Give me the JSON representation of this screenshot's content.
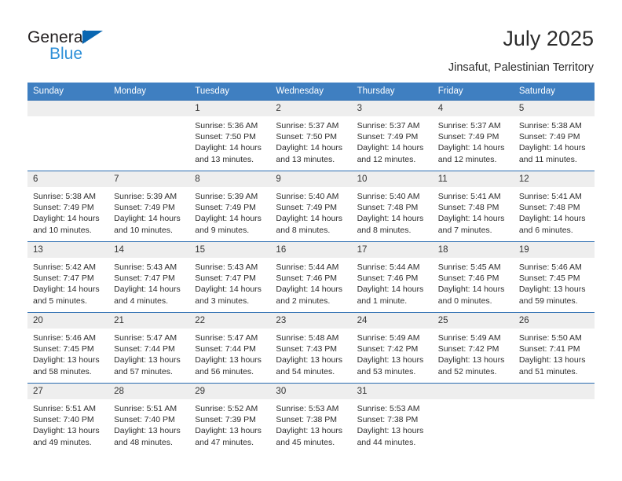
{
  "brand": {
    "name_dark": "General",
    "name_blue": "Blue",
    "accent_blue": "#0a67b2",
    "light_blue": "#2f90d8"
  },
  "header": {
    "title": "July 2025",
    "location": "Jinsafut, Palestinian Territory"
  },
  "theme": {
    "header_bg": "#3f7fc1",
    "row_rule": "#2a6cb0",
    "daynum_bg": "#eeeeee"
  },
  "weekday_headers": [
    "Sunday",
    "Monday",
    "Tuesday",
    "Wednesday",
    "Thursday",
    "Friday",
    "Saturday"
  ],
  "labels": {
    "sunrise": "Sunrise:",
    "sunset": "Sunset:",
    "daylight": "Daylight:"
  },
  "weeks": [
    [
      {
        "day": "",
        "sunrise": "",
        "sunset": "",
        "daylight": ""
      },
      {
        "day": "",
        "sunrise": "",
        "sunset": "",
        "daylight": ""
      },
      {
        "day": "1",
        "sunrise": "Sunrise: 5:36 AM",
        "sunset": "Sunset: 7:50 PM",
        "daylight": "Daylight: 14 hours and 13 minutes."
      },
      {
        "day": "2",
        "sunrise": "Sunrise: 5:37 AM",
        "sunset": "Sunset: 7:50 PM",
        "daylight": "Daylight: 14 hours and 13 minutes."
      },
      {
        "day": "3",
        "sunrise": "Sunrise: 5:37 AM",
        "sunset": "Sunset: 7:49 PM",
        "daylight": "Daylight: 14 hours and 12 minutes."
      },
      {
        "day": "4",
        "sunrise": "Sunrise: 5:37 AM",
        "sunset": "Sunset: 7:49 PM",
        "daylight": "Daylight: 14 hours and 12 minutes."
      },
      {
        "day": "5",
        "sunrise": "Sunrise: 5:38 AM",
        "sunset": "Sunset: 7:49 PM",
        "daylight": "Daylight: 14 hours and 11 minutes."
      }
    ],
    [
      {
        "day": "6",
        "sunrise": "Sunrise: 5:38 AM",
        "sunset": "Sunset: 7:49 PM",
        "daylight": "Daylight: 14 hours and 10 minutes."
      },
      {
        "day": "7",
        "sunrise": "Sunrise: 5:39 AM",
        "sunset": "Sunset: 7:49 PM",
        "daylight": "Daylight: 14 hours and 10 minutes."
      },
      {
        "day": "8",
        "sunrise": "Sunrise: 5:39 AM",
        "sunset": "Sunset: 7:49 PM",
        "daylight": "Daylight: 14 hours and 9 minutes."
      },
      {
        "day": "9",
        "sunrise": "Sunrise: 5:40 AM",
        "sunset": "Sunset: 7:49 PM",
        "daylight": "Daylight: 14 hours and 8 minutes."
      },
      {
        "day": "10",
        "sunrise": "Sunrise: 5:40 AM",
        "sunset": "Sunset: 7:48 PM",
        "daylight": "Daylight: 14 hours and 8 minutes."
      },
      {
        "day": "11",
        "sunrise": "Sunrise: 5:41 AM",
        "sunset": "Sunset: 7:48 PM",
        "daylight": "Daylight: 14 hours and 7 minutes."
      },
      {
        "day": "12",
        "sunrise": "Sunrise: 5:41 AM",
        "sunset": "Sunset: 7:48 PM",
        "daylight": "Daylight: 14 hours and 6 minutes."
      }
    ],
    [
      {
        "day": "13",
        "sunrise": "Sunrise: 5:42 AM",
        "sunset": "Sunset: 7:47 PM",
        "daylight": "Daylight: 14 hours and 5 minutes."
      },
      {
        "day": "14",
        "sunrise": "Sunrise: 5:43 AM",
        "sunset": "Sunset: 7:47 PM",
        "daylight": "Daylight: 14 hours and 4 minutes."
      },
      {
        "day": "15",
        "sunrise": "Sunrise: 5:43 AM",
        "sunset": "Sunset: 7:47 PM",
        "daylight": "Daylight: 14 hours and 3 minutes."
      },
      {
        "day": "16",
        "sunrise": "Sunrise: 5:44 AM",
        "sunset": "Sunset: 7:46 PM",
        "daylight": "Daylight: 14 hours and 2 minutes."
      },
      {
        "day": "17",
        "sunrise": "Sunrise: 5:44 AM",
        "sunset": "Sunset: 7:46 PM",
        "daylight": "Daylight: 14 hours and 1 minute."
      },
      {
        "day": "18",
        "sunrise": "Sunrise: 5:45 AM",
        "sunset": "Sunset: 7:46 PM",
        "daylight": "Daylight: 14 hours and 0 minutes."
      },
      {
        "day": "19",
        "sunrise": "Sunrise: 5:46 AM",
        "sunset": "Sunset: 7:45 PM",
        "daylight": "Daylight: 13 hours and 59 minutes."
      }
    ],
    [
      {
        "day": "20",
        "sunrise": "Sunrise: 5:46 AM",
        "sunset": "Sunset: 7:45 PM",
        "daylight": "Daylight: 13 hours and 58 minutes."
      },
      {
        "day": "21",
        "sunrise": "Sunrise: 5:47 AM",
        "sunset": "Sunset: 7:44 PM",
        "daylight": "Daylight: 13 hours and 57 minutes."
      },
      {
        "day": "22",
        "sunrise": "Sunrise: 5:47 AM",
        "sunset": "Sunset: 7:44 PM",
        "daylight": "Daylight: 13 hours and 56 minutes."
      },
      {
        "day": "23",
        "sunrise": "Sunrise: 5:48 AM",
        "sunset": "Sunset: 7:43 PM",
        "daylight": "Daylight: 13 hours and 54 minutes."
      },
      {
        "day": "24",
        "sunrise": "Sunrise: 5:49 AM",
        "sunset": "Sunset: 7:42 PM",
        "daylight": "Daylight: 13 hours and 53 minutes."
      },
      {
        "day": "25",
        "sunrise": "Sunrise: 5:49 AM",
        "sunset": "Sunset: 7:42 PM",
        "daylight": "Daylight: 13 hours and 52 minutes."
      },
      {
        "day": "26",
        "sunrise": "Sunrise: 5:50 AM",
        "sunset": "Sunset: 7:41 PM",
        "daylight": "Daylight: 13 hours and 51 minutes."
      }
    ],
    [
      {
        "day": "27",
        "sunrise": "Sunrise: 5:51 AM",
        "sunset": "Sunset: 7:40 PM",
        "daylight": "Daylight: 13 hours and 49 minutes."
      },
      {
        "day": "28",
        "sunrise": "Sunrise: 5:51 AM",
        "sunset": "Sunset: 7:40 PM",
        "daylight": "Daylight: 13 hours and 48 minutes."
      },
      {
        "day": "29",
        "sunrise": "Sunrise: 5:52 AM",
        "sunset": "Sunset: 7:39 PM",
        "daylight": "Daylight: 13 hours and 47 minutes."
      },
      {
        "day": "30",
        "sunrise": "Sunrise: 5:53 AM",
        "sunset": "Sunset: 7:38 PM",
        "daylight": "Daylight: 13 hours and 45 minutes."
      },
      {
        "day": "31",
        "sunrise": "Sunrise: 5:53 AM",
        "sunset": "Sunset: 7:38 PM",
        "daylight": "Daylight: 13 hours and 44 minutes."
      },
      {
        "day": "",
        "sunrise": "",
        "sunset": "",
        "daylight": ""
      },
      {
        "day": "",
        "sunrise": "",
        "sunset": "",
        "daylight": ""
      }
    ]
  ]
}
